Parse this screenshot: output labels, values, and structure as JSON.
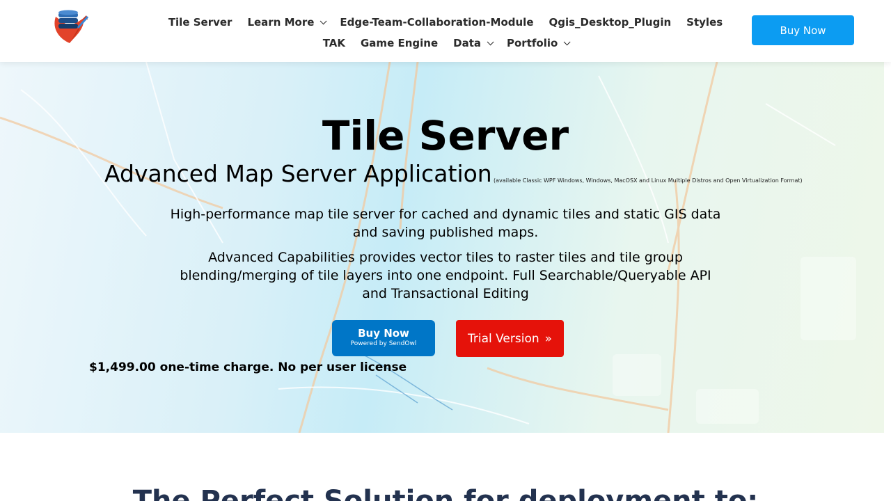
{
  "header": {
    "nav_row1": [
      {
        "label": "Tile Server",
        "has_dropdown": false
      },
      {
        "label": "Learn More",
        "has_dropdown": true
      },
      {
        "label": "Edge-Team-Collaboration-Module",
        "has_dropdown": false
      },
      {
        "label": "Qgis_Desktop_Plugin",
        "has_dropdown": false
      },
      {
        "label": "Styles",
        "has_dropdown": false
      }
    ],
    "nav_row2": [
      {
        "label": "TAK",
        "has_dropdown": false
      },
      {
        "label": "Game Engine",
        "has_dropdown": false
      },
      {
        "label": "Data",
        "has_dropdown": true
      },
      {
        "label": "Portfolio",
        "has_dropdown": true
      }
    ],
    "buy_button": "Buy Now"
  },
  "hero": {
    "title": "Tile Server",
    "subtitle": "Advanced Map Server Application",
    "subtitle_note": "(available Classic WPF Windows, Windows, MacOSX and Linux Multiple Distros and Open Virtualization Format)",
    "paragraph1": "High-performance map tile server for cached and dynamic tiles and static GIS data and saving published maps.",
    "paragraph2": "Advanced Capabilities provides vector tiles to raster tiles and tile group blending/merging of tile layers into one endpoint.  Full Searchable/Queryable API and Transactional Editing",
    "buy_sendowl_label": "Buy Now",
    "buy_sendowl_sub": "Powered by SendOwl",
    "trial_label": "Trial Version",
    "trial_icon": "double-chevron-right-icon",
    "price": "$1,499.00 one-time charge. No per user license"
  },
  "section": {
    "title": "The Perfect Solution for deployment to:"
  },
  "colors": {
    "accent_blue": "#0c9cf2",
    "sendowl_blue": "#0076c7",
    "trial_red": "#e5120a",
    "section_title": "#23324f"
  }
}
